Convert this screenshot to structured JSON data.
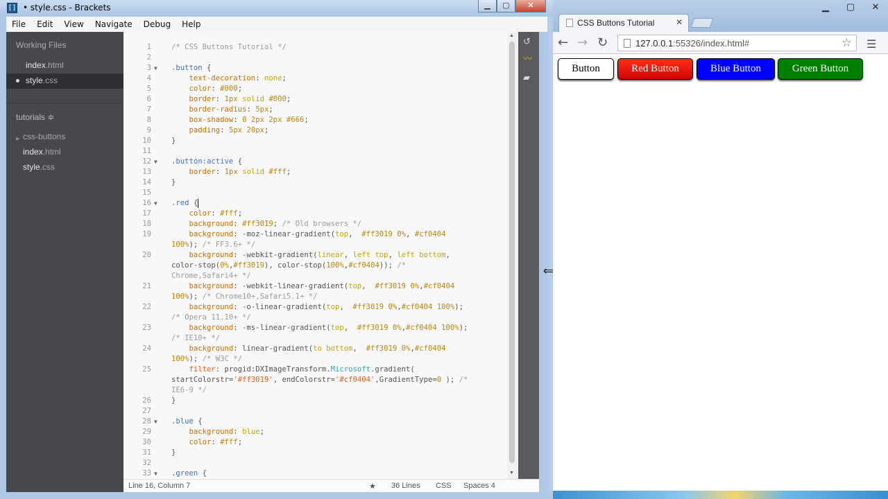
{
  "brackets": {
    "window_title": "• style.css - Brackets",
    "menu": [
      "File",
      "Edit",
      "View",
      "Navigate",
      "Debug",
      "Help"
    ],
    "sidebar": {
      "working_files_label": "Working Files",
      "working_files": [
        {
          "name": "index",
          "ext": ".html"
        },
        {
          "name": "style",
          "ext": ".css"
        }
      ],
      "project_label": "tutorials ≑",
      "tree": [
        {
          "name": "css-buttons",
          "ext": ""
        },
        {
          "name": "index",
          "ext": ".html"
        },
        {
          "name": "style",
          "ext": ".css"
        }
      ]
    },
    "status": {
      "position": "Line 16, Column 7",
      "lines": "36 Lines",
      "mode": "CSS",
      "indent": "Spaces 4"
    }
  },
  "code_lines": [
    {
      "n": "1",
      "fold": "",
      "html": "<span class='c-com'>/* CSS Buttons Tutorial */</span>"
    },
    {
      "n": "2",
      "fold": "",
      "html": ""
    },
    {
      "n": "3",
      "fold": "▼",
      "html": "<span class='c-sel'>.button</span> {"
    },
    {
      "n": "4",
      "fold": "",
      "html": "    <span class='c-prop'>text-decoration</span>: <span class='c-kw'>none</span>;"
    },
    {
      "n": "5",
      "fold": "",
      "html": "    <span class='c-prop'>color</span>: <span class='c-num'>#000</span>;"
    },
    {
      "n": "6",
      "fold": "",
      "html": "    <span class='c-prop'>border</span>: <span class='c-num'>1px</span> <span class='c-kw'>solid</span> <span class='c-num'>#000</span>;"
    },
    {
      "n": "7",
      "fold": "",
      "html": "    <span class='c-prop'>border-radius</span>: <span class='c-num'>5px</span>;"
    },
    {
      "n": "8",
      "fold": "",
      "html": "    <span class='c-prop'>box-shadow</span>: <span class='c-num'>0 2px 2px #666</span>;"
    },
    {
      "n": "9",
      "fold": "",
      "html": "    <span class='c-prop'>padding</span>: <span class='c-num'>5px 20px</span>;"
    },
    {
      "n": "10",
      "fold": "",
      "html": "}"
    },
    {
      "n": "11",
      "fold": "",
      "html": ""
    },
    {
      "n": "12",
      "fold": "▼",
      "html": "<span class='c-sel'>.button:active</span> {"
    },
    {
      "n": "13",
      "fold": "",
      "html": "    <span class='c-prop'>border</span>: <span class='c-num'>1px</span> <span class='c-kw'>solid</span> <span class='c-num'>#fff</span>;"
    },
    {
      "n": "14",
      "fold": "",
      "html": "}"
    },
    {
      "n": "15",
      "fold": "",
      "html": ""
    },
    {
      "n": "16",
      "fold": "▼",
      "html": "<span class='c-sel'>.red</span> {<span class='cursor'></span>"
    },
    {
      "n": "17",
      "fold": "",
      "html": "    <span class='c-prop'>color</span>: <span class='c-num'>#fff</span>;"
    },
    {
      "n": "18",
      "fold": "",
      "html": "    <span class='c-prop'>background</span>: <span class='c-num'>#ff3019</span>; <span class='c-com'>/* Old browsers */</span>"
    },
    {
      "n": "19",
      "fold": "",
      "html": "    <span class='c-prop'>background</span>: -moz-linear-gradient(<span class='c-kw'>top</span>,  <span class='c-num'>#ff3019 0%</span>, <span class='c-num'>#cf0404</span>"
    },
    {
      "n": "",
      "fold": "",
      "html": "<span class='c-num'>100%</span>); <span class='c-com'>/* FF3.6+ */</span>"
    },
    {
      "n": "20",
      "fold": "",
      "html": "    <span class='c-prop'>background</span>: -webkit-gradient(<span class='c-kw'>linear</span>, <span class='c-kw'>left top</span>, <span class='c-kw'>left bottom</span>,"
    },
    {
      "n": "",
      "fold": "",
      "html": "color-stop(<span class='c-num'>0%</span>,<span class='c-num'>#ff3019</span>), color-stop(<span class='c-num'>100%</span>,<span class='c-num'>#cf0404</span>)); <span class='c-com'>/*</span>"
    },
    {
      "n": "",
      "fold": "",
      "html": "<span class='c-com'>Chrome,Safari4+ */</span>"
    },
    {
      "n": "21",
      "fold": "",
      "html": "    <span class='c-prop'>background</span>: -webkit-linear-gradient(<span class='c-kw'>top</span>,  <span class='c-num'>#ff3019 0%</span>,<span class='c-num'>#cf0404</span>"
    },
    {
      "n": "",
      "fold": "",
      "html": "<span class='c-num'>100%</span>); <span class='c-com'>/* Chrome10+,Safari5.1+ */</span>"
    },
    {
      "n": "22",
      "fold": "",
      "html": "    <span class='c-prop'>background</span>: -o-linear-gradient(<span class='c-kw'>top</span>,  <span class='c-num'>#ff3019 0%</span>,<span class='c-num'>#cf0404 100%</span>);"
    },
    {
      "n": "",
      "fold": "",
      "html": "<span class='c-com'>/* Opera 11.10+ */</span>"
    },
    {
      "n": "23",
      "fold": "",
      "html": "    <span class='c-prop'>background</span>: -ms-linear-gradient(<span class='c-kw'>top</span>,  <span class='c-num'>#ff3019 0%</span>,<span class='c-num'>#cf0404 100%</span>);"
    },
    {
      "n": "",
      "fold": "",
      "html": "<span class='c-com'>/* IE10+ */</span>"
    },
    {
      "n": "24",
      "fold": "",
      "html": "    <span class='c-prop'>background</span>: linear-gradient(<span class='c-kw'>to bottom</span>,  <span class='c-num'>#ff3019 0%</span>,<span class='c-num'>#cf0404</span>"
    },
    {
      "n": "",
      "fold": "",
      "html": "<span class='c-num'>100%</span>); <span class='c-com'>/* W3C */</span>"
    },
    {
      "n": "25",
      "fold": "",
      "html": "    <span class='c-str'>filter</span>: progid:DXImageTransform.<span class='c-ms'>Microsoft</span>.gradient("
    },
    {
      "n": "",
      "fold": "",
      "html": "startColorstr=<span class='c-str'>'#ff3019'</span>, endColorstr=<span class='c-str'>'#cf0404'</span>,GradientType=<span class='c-num'>0</span> ); <span class='c-com'>/*</span>"
    },
    {
      "n": "",
      "fold": "",
      "html": "<span class='c-com'>IE6-9 */</span>"
    },
    {
      "n": "26",
      "fold": "",
      "html": "}"
    },
    {
      "n": "27",
      "fold": "",
      "html": ""
    },
    {
      "n": "28",
      "fold": "▼",
      "html": "<span class='c-sel'>.blue</span> {"
    },
    {
      "n": "29",
      "fold": "",
      "html": "    <span class='c-prop'>background</span>: <span class='c-kw'>blue</span>;"
    },
    {
      "n": "30",
      "fold": "",
      "html": "    <span class='c-prop'>color</span>: <span class='c-num'>#fff</span>;"
    },
    {
      "n": "31",
      "fold": "",
      "html": "}"
    },
    {
      "n": "32",
      "fold": "",
      "html": ""
    },
    {
      "n": "33",
      "fold": "▼",
      "html": "<span class='c-sel'>.green</span> {"
    }
  ],
  "chrome": {
    "tab_title": "CSS Buttons Tutorial",
    "url_host": "127.0.0.1",
    "url_rest": ":55326/index.html#",
    "buttons": [
      "Button",
      "Red Button",
      "Blue Button",
      "Green Button"
    ]
  }
}
